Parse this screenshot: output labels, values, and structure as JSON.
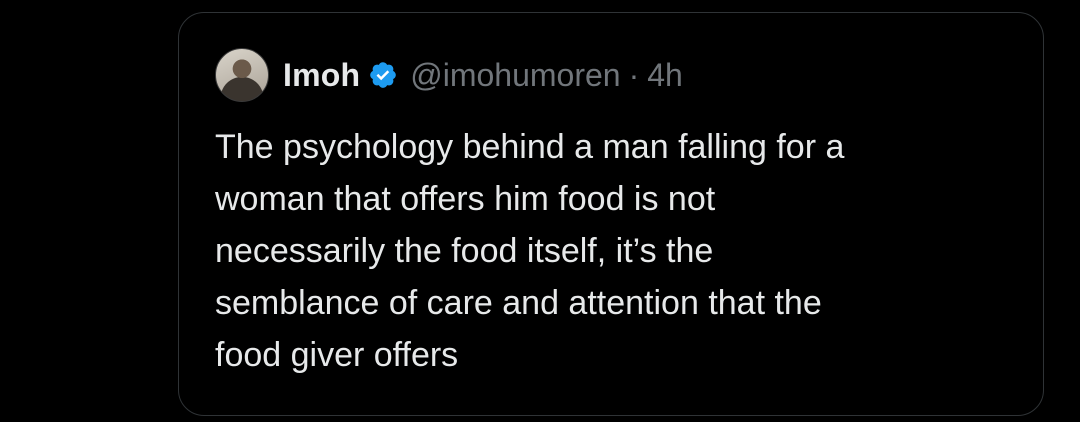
{
  "quote": {
    "display_name": "Imoh",
    "handle": "@imohumoren",
    "separator": "·",
    "time": "4h",
    "avatar_icon": "user-avatar",
    "verified_icon": "verified-badge-icon",
    "verified_color": "#1d9bf0",
    "text": "The psychology behind a man falling for a\nwoman that offers him food is not\nnecessarily the food itself, it’s the\nsemblance of care and attention that the\nfood giver offers"
  }
}
